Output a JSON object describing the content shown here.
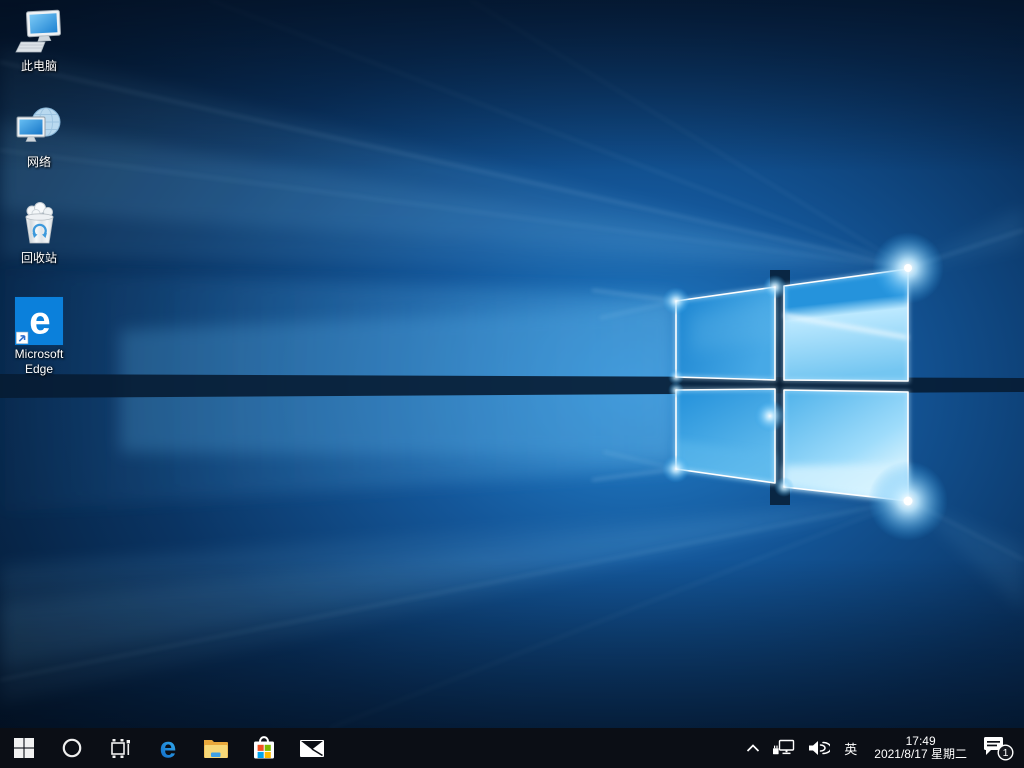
{
  "desktop": {
    "icons": [
      {
        "name": "this-pc",
        "label": "此电脑"
      },
      {
        "name": "network",
        "label": "网络"
      },
      {
        "name": "recycle-bin",
        "label": "回收站"
      },
      {
        "name": "microsoft-edge-shortcut",
        "label": "Microsoft Edge",
        "glyph": "e"
      }
    ]
  },
  "taskbar": {
    "buttons": [
      {
        "name": "start",
        "icon": "windows-logo-icon"
      },
      {
        "name": "cortana-search",
        "icon": "cortana-circle-icon"
      },
      {
        "name": "task-view",
        "icon": "task-view-icon"
      },
      {
        "name": "microsoft-edge",
        "icon": "edge-icon",
        "glyph": "e"
      },
      {
        "name": "file-explorer",
        "icon": "folder-icon"
      },
      {
        "name": "microsoft-store",
        "icon": "store-bag-icon"
      },
      {
        "name": "mail",
        "icon": "mail-envelope-icon"
      }
    ],
    "tray": {
      "hidden_icons": "show-hidden-icons-chevron",
      "network_icon": "ethernet-network-icon",
      "volume_icon": "speaker-volume-icon",
      "language_indicator": "英",
      "time": "17:49",
      "date": "2021/8/17 星期二",
      "notification_count": "1"
    }
  },
  "colors": {
    "taskbar_bg": "#0b0e15",
    "wallpaper_dark": "#041830",
    "wallpaper_accent": "#2ea6f0",
    "edge_blue": "#0b80db",
    "folder_yellow": "#f7d878",
    "store_red": "#f25022",
    "store_green": "#7fba00",
    "store_blue": "#00a4ef",
    "store_yellow": "#ffb900"
  }
}
